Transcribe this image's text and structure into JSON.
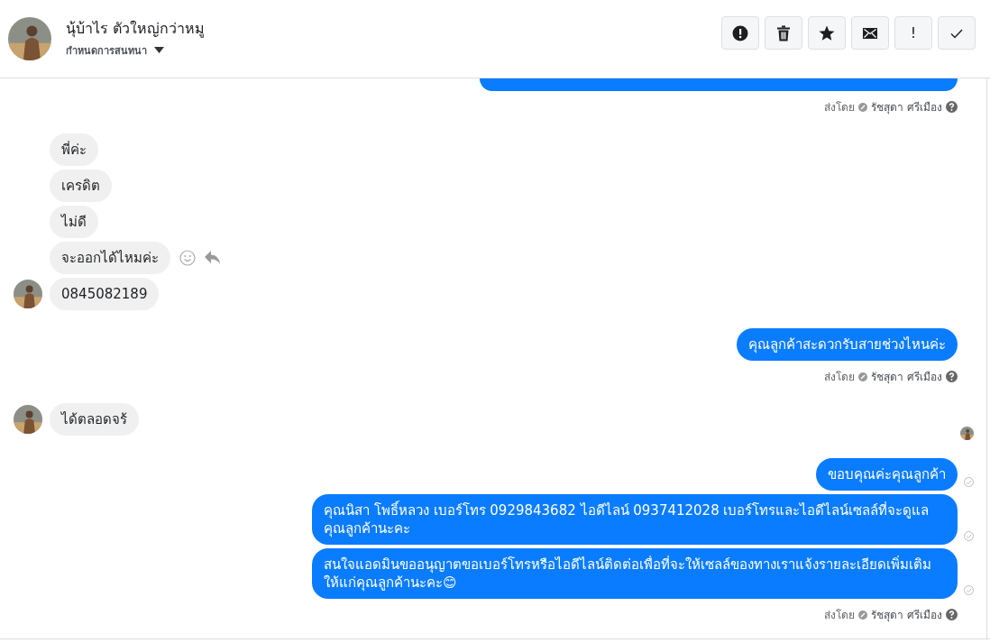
{
  "header": {
    "name": "นุ้บ้าไร ตัวใหญ่กว่าหมู",
    "subtitle": "กำหนดการสนทนา"
  },
  "toolbar": [
    {
      "kind": "alert"
    },
    {
      "kind": "trash"
    },
    {
      "kind": "star"
    },
    {
      "kind": "mail"
    },
    {
      "kind": "text",
      "label": "!"
    },
    {
      "kind": "check"
    }
  ],
  "groups": [
    {
      "kind": "outgoing",
      "partial": true,
      "sent_by": {
        "label": "ส่งโดย",
        "name": "รัชสุดา ศรีเมือง"
      }
    },
    {
      "kind": "incoming",
      "messages": [
        {
          "text": "พี่ค่ะ"
        },
        {
          "text": "เครดิต"
        },
        {
          "text": "ไม่ดี"
        },
        {
          "text": "จะออกได้ไหมค่ะ",
          "hover_actions": true
        },
        {
          "text": "0845082189",
          "avatar": true
        }
      ]
    },
    {
      "kind": "outgoing",
      "messages": [
        {
          "text": "คุณลูกค้าสะดวกรับสายช่วงไหนค่ะ"
        }
      ],
      "sent_by": {
        "label": "ส่งโดย",
        "name": "รัชสุดา ศรีเมือง"
      }
    },
    {
      "kind": "incoming",
      "messages": [
        {
          "text": "ได้ตลอดจร้",
          "avatar": true
        }
      ],
      "seen": true
    },
    {
      "kind": "outgoing",
      "messages": [
        {
          "text": "ขอบคุณค่ะคุณลูกค้า",
          "delivered": true
        },
        {
          "text": "คุณนิสา โพธิ์หลวง  เบอร์โทร 0929843682  ไอดีไลน์ 0937412028  เบอร์โทรและไอดีไลน์เซลล์ที่จะดูแลคุณลูกค้านะคะ",
          "delivered": true
        },
        {
          "text": "สนใจแอดมินขออนุญาตขอเบอร์โทรหรือไอดีไลน์ติดต่อเพื่อที่จะให้เซลล์ของทางเราแจ้งรายละเอียดเพิ่มเติมให้แก่คุณลูกค้านะคะ😊",
          "delivered": true
        }
      ],
      "sent_by": {
        "label": "ส่งโดย",
        "name": "รัชสุดา ศรีเมือง"
      }
    }
  ]
}
